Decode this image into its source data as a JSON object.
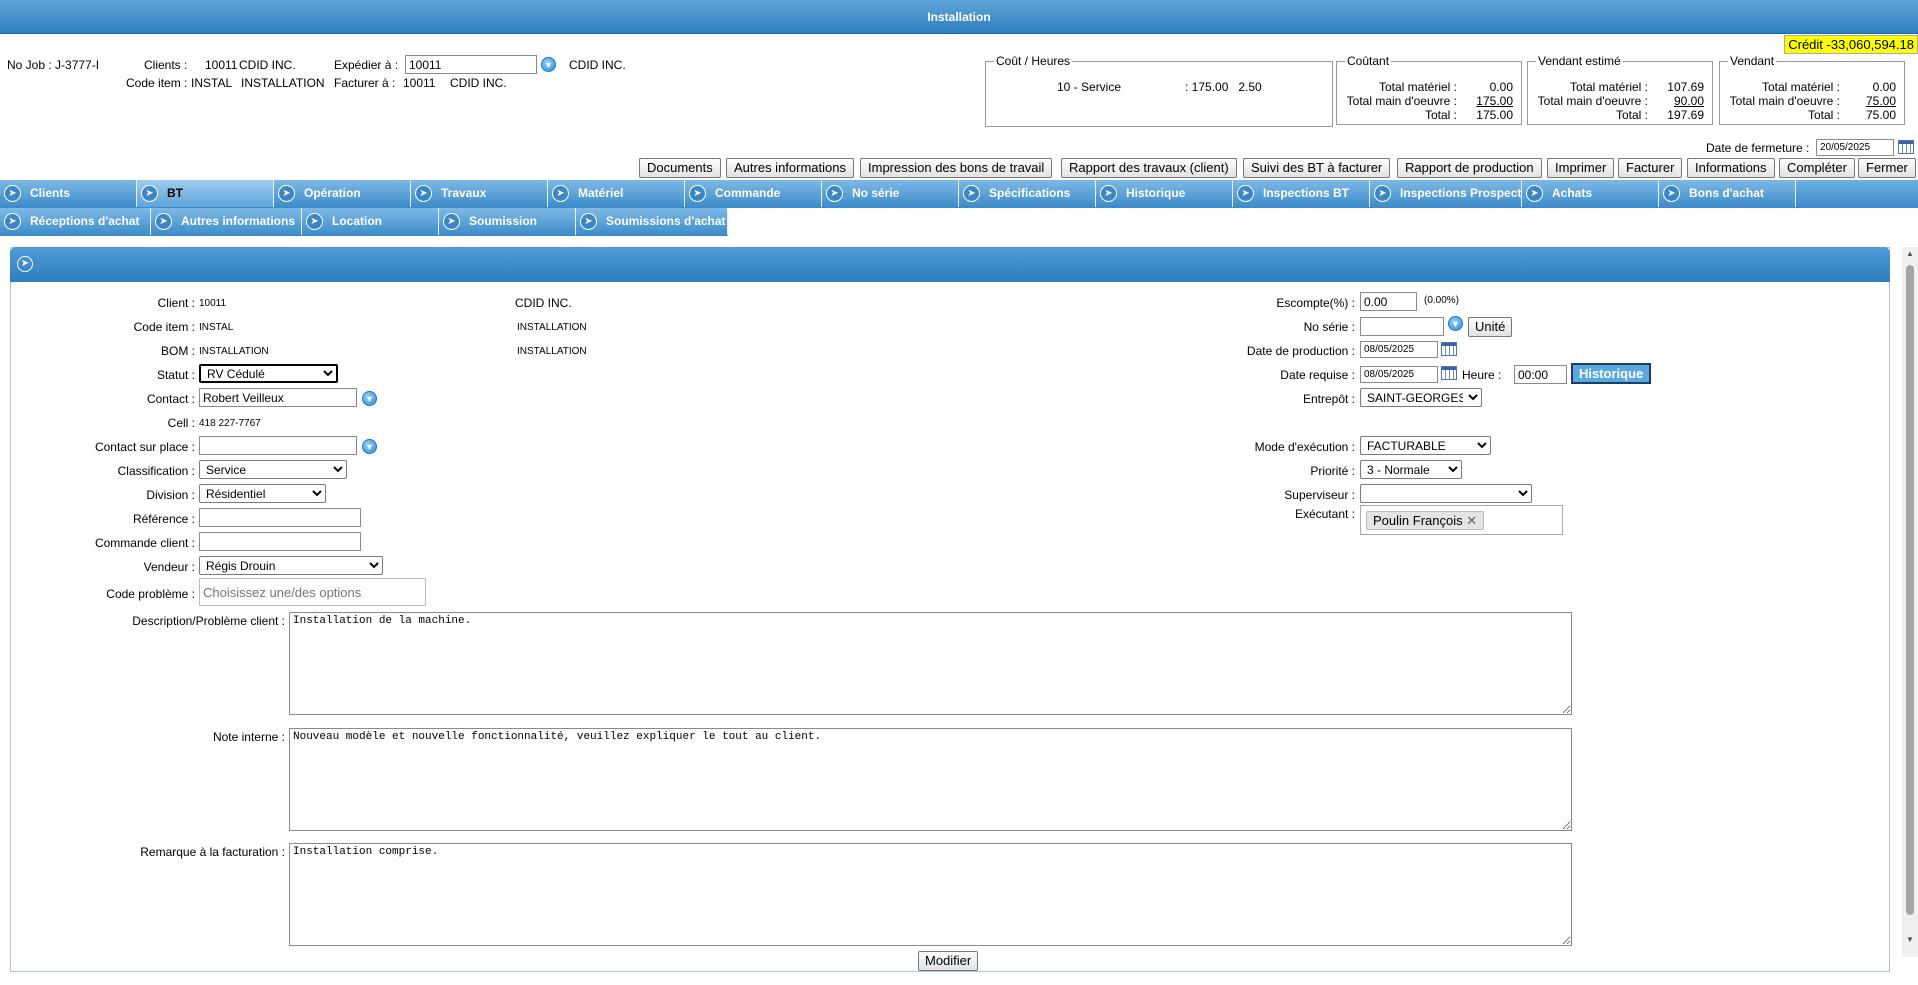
{
  "window": {
    "title": "Installation"
  },
  "credit": "Crédit -33,060,594.18",
  "header": {
    "job": "No Job : J-3777-I",
    "clients_label": "Clients :",
    "clients_code": "10011",
    "clients_name": "CDID INC.",
    "item_label": "Code item :",
    "item_code": "INSTAL",
    "item_name": "INSTALLATION",
    "ship_label": "Expédier à :",
    "ship_value": "10011",
    "ship_name": "CDID INC.",
    "bill_label": "Facturer à :",
    "bill_code": "10011",
    "bill_name": "CDID INC."
  },
  "cost_hours": {
    "legend": "Coût / Heures",
    "line_name": "10 - Service",
    "line_values": ": 175.00   2.50"
  },
  "coutant": {
    "legend": "Coûtant",
    "materiel_label": "Total matériel :",
    "materiel": "0.00",
    "main_label": "Total main d'oeuvre :",
    "main": "175.00",
    "total_label": "Total :",
    "total": "175.00"
  },
  "vendant_estime": {
    "legend": "Vendant estimé",
    "materiel_label": "Total matériel :",
    "materiel": "107.69",
    "main_label": "Total main d'oeuvre :",
    "main": "90.00",
    "total_label": "Total :",
    "total": "197.69"
  },
  "vendant": {
    "legend": "Vendant",
    "materiel_label": "Total matériel :",
    "materiel": "0.00",
    "main_label": "Total main d'oeuvre :",
    "main": "75.00",
    "total_label": "Total :",
    "total": "75.00"
  },
  "closing": {
    "label": "Date de fermeture :",
    "value": "20/05/2025"
  },
  "toolbar": {
    "documents": "Documents",
    "autres": "Autres informations",
    "impression": "Impression des bons de travail",
    "rapport_travaux": "Rapport des travaux (client)",
    "suivi": "Suivi des BT à facturer",
    "rapport_production": "Rapport de production",
    "imprimer": "Imprimer",
    "facturer": "Facturer",
    "informations": "Informations",
    "completer": "Compléter",
    "fermer": "Fermer"
  },
  "tabs_row1": [
    "Clients",
    "BT",
    "Opération",
    "Travaux",
    "Matériel",
    "Commande",
    "No série",
    "Spécifications",
    "Historique",
    "Inspections BT",
    "Inspections Prospect",
    "Achats",
    "Bons d'achat"
  ],
  "tabs_row2": [
    "Réceptions d'achat",
    "Autres informations",
    "Location",
    "Soumission",
    "Soumissions d'achat"
  ],
  "form": {
    "client_label": "Client :",
    "client_code": "10011",
    "client_name": "CDID INC.",
    "item_label": "Code item :",
    "item_code": "INSTAL",
    "item_name": "INSTALLATION",
    "bom_label": "BOM :",
    "bom_code": "INSTALLATION",
    "bom_name": "INSTALLATION",
    "statut_label": "Statut :",
    "statut_value": "RV Cédulé",
    "contact_label": "Contact :",
    "contact_value": "Robert Veilleux",
    "cell_label": "Cell :",
    "cell_value": "418 227-7767",
    "contact_place_label": "Contact sur place :",
    "contact_place_value": "",
    "classification_label": "Classification :",
    "classification_value": "Service",
    "division_label": "Division :",
    "division_value": "Résidentiel",
    "reference_label": "Référence :",
    "reference_value": "",
    "commande_label": "Commande client :",
    "commande_value": "",
    "vendeur_label": "Vendeur :",
    "vendeur_value": "Régis Drouin",
    "code_probleme_label": "Code problème :",
    "code_probleme_placeholder": "Choisissez une/des options",
    "description_label": "Description/Problème client :",
    "description_value": "Installation de la machine.",
    "note_label": "Note interne :",
    "note_value": "Nouveau modèle et nouvelle fonctionnalité, veuillez expliquer le tout au client.",
    "remarque_label": "Remarque à la facturation :",
    "remarque_value": "Installation comprise.",
    "escompte_label": "Escompte(%) :",
    "escompte_value": "0.00",
    "escompte_pct": "(0.00%)",
    "noserie_label": "No série :",
    "noserie_value": "",
    "unite_button": "Unité",
    "date_prod_label": "Date de production :",
    "date_prod_value": "08/05/2025",
    "date_req_label": "Date requise :",
    "date_req_value": "08/05/2025",
    "heure_label": "Heure :",
    "heure_value": "00:00",
    "historique_button": "Historique",
    "entrepot_label": "Entrepôt :",
    "entrepot_value": "SAINT-GEORGES",
    "mode_label": "Mode d'exécution :",
    "mode_value": "FACTURABLE",
    "priorite_label": "Priorité :",
    "priorite_value": "3 - Normale",
    "superviseur_label": "Superviseur :",
    "superviseur_value": "",
    "executant_label": "Exécutant :",
    "executant_chip": "Poulin François",
    "modifier_button": "Modifier"
  }
}
